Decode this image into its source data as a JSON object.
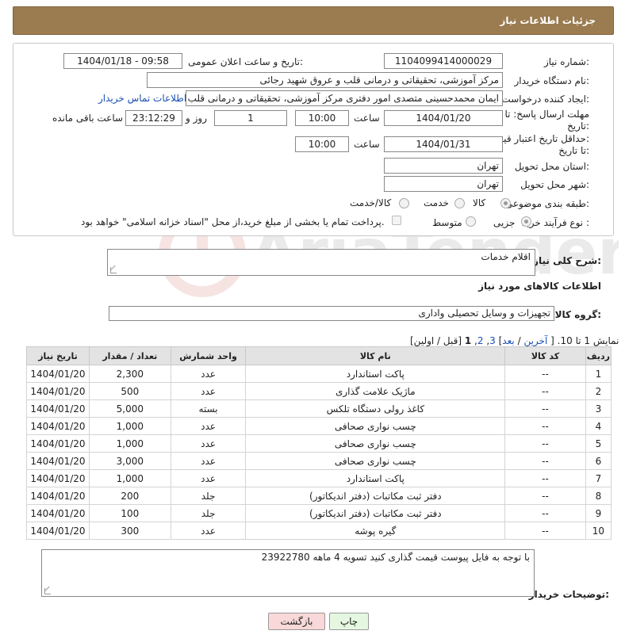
{
  "header": {
    "title": "جزئیات اطلاعات نیاز"
  },
  "form": {
    "need_number_label": "شماره نیاز:",
    "need_number": "1104099414000029",
    "announce_label": "تاریخ و ساعت اعلان عمومی:",
    "announce_value": "1404/01/18 - 09:58",
    "buyer_org_label": "نام دستگاه خریدار:",
    "buyer_org": "مرکز آموزشی، تحقیقاتی و درمانی قلب و عروق شهید رجائی",
    "creator_label": "ایجاد کننده درخواست:",
    "creator": "ایمان محمدحسینی متصدی امور دفتری مرکز آموزشی، تحقیقاتی و درمانی قلب",
    "contact_link": "اطلاعات تماس خریدار",
    "deadline_label_1": "مهلت ارسال پاسخ: تا",
    "deadline_label_2": "تاریخ:",
    "deadline_date": "1404/01/20",
    "time_label": "ساعت",
    "deadline_time": "10:00",
    "days_value": "1",
    "days_label": "روز و",
    "remaining_time": "23:12:29",
    "remaining_label": "ساعت باقی مانده",
    "validity_label_1": "حداقل تاریخ اعتبار قیمت:",
    "validity_label_2": "تا تاریخ:",
    "validity_date": "1404/01/31",
    "validity_time": "10:00",
    "province_label": "استان محل تحویل:",
    "province": "تهران",
    "city_label": "شهر محل تحویل:",
    "city": "تهران",
    "category_label": "طبقه بندی موضوعی:",
    "category_options": [
      "کالا",
      "خدمت",
      "کالا/خدمت"
    ],
    "category_selected": "کالا",
    "purchase_type_label": "نوع فرآیند خرید :",
    "purchase_options": [
      "جزیی",
      "متوسط"
    ],
    "purchase_selected": "جزیی",
    "payment_note": "پرداخت تمام یا بخشی از مبلغ خرید،از محل \"اسناد خزانه اسلامی\" خواهد بود."
  },
  "summary": {
    "label": "شرح کلی نیاز:",
    "value": "اقلام خدمات"
  },
  "goods_section_title": "اطلاعات کالاهای مورد نیاز",
  "goods_group": {
    "label": "گروه کالا:",
    "value": "تجهیزات و وسایل تحصیلی واداری"
  },
  "pagination": {
    "prefix": "نمایش 1 تا 10.",
    "bracket_open": "[",
    "last": "آخرین",
    "sep1": "/",
    "next": "بعد",
    "bracket_close": "]",
    "page3": "3",
    "page2": "2",
    "page1": "1",
    "prev_first": "[قبل / اولین]"
  },
  "table": {
    "headers": [
      "ردیف",
      "کد کالا",
      "نام کالا",
      "واحد شمارش",
      "تعداد / مقدار",
      "تاریخ نیاز"
    ],
    "rows": [
      [
        "1",
        "--",
        "پاکت استاندارد",
        "عدد",
        "2,300",
        "1404/01/20"
      ],
      [
        "2",
        "--",
        "ماژیک علامت گذاری",
        "عدد",
        "500",
        "1404/01/20"
      ],
      [
        "3",
        "--",
        "کاغذ رولی دستگاه تلکس",
        "بسته",
        "5,000",
        "1404/01/20"
      ],
      [
        "4",
        "--",
        "چسب نواری صحافی",
        "عدد",
        "1,000",
        "1404/01/20"
      ],
      [
        "5",
        "--",
        "چسب نواری صحافی",
        "عدد",
        "1,000",
        "1404/01/20"
      ],
      [
        "6",
        "--",
        "چسب نواری صحافی",
        "عدد",
        "3,000",
        "1404/01/20"
      ],
      [
        "7",
        "--",
        "پاکت استاندارد",
        "عدد",
        "1,000",
        "1404/01/20"
      ],
      [
        "8",
        "--",
        "دفتر ثبت مکاتبات (دفتر اندیکاتور)",
        "جلد",
        "200",
        "1404/01/20"
      ],
      [
        "9",
        "--",
        "دفتر ثبت مکاتبات (دفتر اندیکاتور)",
        "جلد",
        "100",
        "1404/01/20"
      ],
      [
        "10",
        "--",
        "گیره پوشه",
        "عدد",
        "300",
        "1404/01/20"
      ]
    ]
  },
  "buyer_notes": {
    "label": "توضیحات خریدار:",
    "value": "با توجه به فایل پیوست قیمت گذاری کنید تسویه 4 ماهه 23922780"
  },
  "buttons": {
    "print": "چاپ",
    "back": "بازگشت"
  },
  "watermark": {
    "text": "AriaTender.neT"
  },
  "colors": {
    "header_bg": "#9b7b50",
    "link": "#1a4fb4",
    "back_button_bg": "#f8d8d8",
    "print_button_bg": "#e6f7e1"
  }
}
